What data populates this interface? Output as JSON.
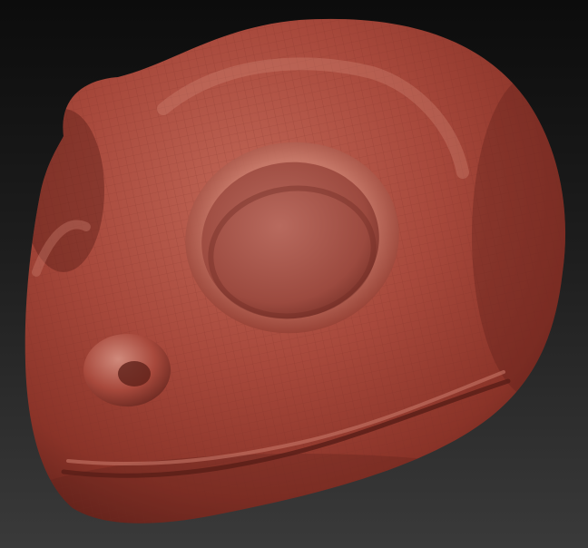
{
  "viewport": {
    "background_top": "#0c0c0c",
    "background_bottom": "#3a3a3a"
  },
  "model": {
    "material_base": "#a3453a",
    "material_light": "#c46a5c",
    "material_shadow": "#5e2019",
    "wireframe_visible": true,
    "wireframe_color": "#7a2d25"
  }
}
